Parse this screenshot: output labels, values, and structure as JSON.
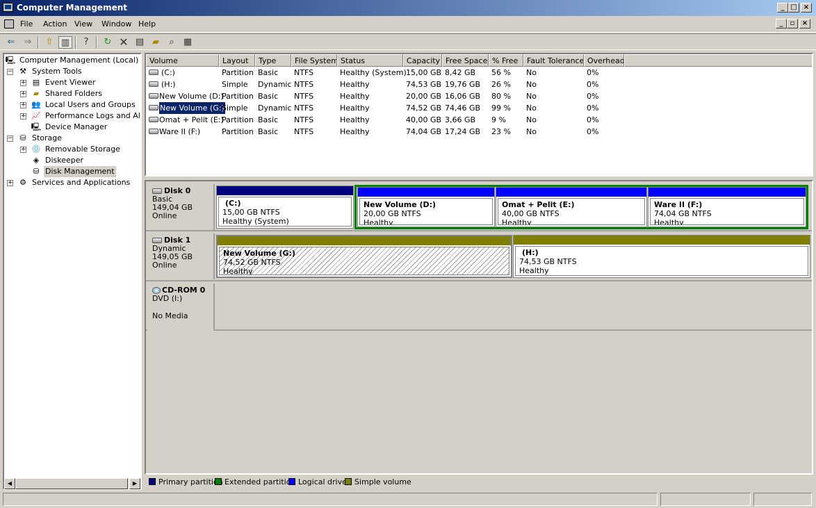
{
  "window": {
    "title": "Computer Management"
  },
  "menu": [
    "File",
    "Action",
    "View",
    "Window",
    "Help"
  ],
  "tree": {
    "root": "Computer Management (Local)",
    "system_tools": "System Tools",
    "event_viewer": "Event Viewer",
    "shared_folders": "Shared Folders",
    "local_users": "Local Users and Groups",
    "perf_logs": "Performance Logs and Alerts",
    "device_manager": "Device Manager",
    "storage": "Storage",
    "removable_storage": "Removable Storage",
    "diskeeper": "Diskeeper",
    "disk_management": "Disk Management",
    "services": "Services and Applications"
  },
  "list": {
    "columns": [
      "Volume",
      "Layout",
      "Type",
      "File System",
      "Status",
      "Capacity",
      "Free Space",
      "% Free",
      "Fault Tolerance",
      "Overhead"
    ],
    "rows": [
      [
        "(C:)",
        "Partition",
        "Basic",
        "NTFS",
        "Healthy (System)",
        "15,00 GB",
        "8,42 GB",
        "56 %",
        "No",
        "0%"
      ],
      [
        "(H:)",
        "Simple",
        "Dynamic",
        "NTFS",
        "Healthy",
        "74,53 GB",
        "19,76 GB",
        "26 %",
        "No",
        "0%"
      ],
      [
        "New Volume (D:)",
        "Partition",
        "Basic",
        "NTFS",
        "Healthy",
        "20,00 GB",
        "16,06 GB",
        "80 %",
        "No",
        "0%"
      ],
      [
        "New Volume (G:)",
        "Simple",
        "Dynamic",
        "NTFS",
        "Healthy",
        "74,52 GB",
        "74,46 GB",
        "99 %",
        "No",
        "0%"
      ],
      [
        "Omat + Pelit (E:)",
        "Partition",
        "Basic",
        "NTFS",
        "Healthy",
        "40,00 GB",
        "3,66 GB",
        "9 %",
        "No",
        "0%"
      ],
      [
        "Ware II (F:)",
        "Partition",
        "Basic",
        "NTFS",
        "Healthy",
        "74,04 GB",
        "17,24 GB",
        "23 %",
        "No",
        "0%"
      ]
    ]
  },
  "disks": {
    "d0": {
      "name": "Disk 0",
      "type": "Basic",
      "size": "149,04 GB",
      "state": "Online"
    },
    "d1": {
      "name": "Disk 1",
      "type": "Dynamic",
      "size": "149,05 GB",
      "state": "Online"
    },
    "cd": {
      "name": "CD-ROM 0",
      "type": "DVD (I:)",
      "state": "No Media"
    }
  },
  "volumes": {
    "c": {
      "name": "(C:)",
      "size": "15,00 GB NTFS",
      "status": "Healthy (System)"
    },
    "d": {
      "name": "New Volume  (D:)",
      "size": "20,00 GB NTFS",
      "status": "Healthy"
    },
    "e": {
      "name": "Omat + Pelit  (E:)",
      "size": "40,00 GB NTFS",
      "status": "Healthy"
    },
    "f": {
      "name": "Ware II  (F:)",
      "size": "74,04 GB NTFS",
      "status": "Healthy"
    },
    "g": {
      "name": "New Volume  (G:)",
      "size": "74,52 GB NTFS",
      "status": "Healthy"
    },
    "h": {
      "name": "(H:)",
      "size": "74,53 GB NTFS",
      "status": "Healthy"
    }
  },
  "legend": {
    "primary": "Primary partition",
    "extended": "Extended partition",
    "logical": "Logical drive",
    "simple": "Simple volume"
  },
  "colors": {
    "primary": "#000080",
    "extended": "#008000",
    "logical": "#0000ff",
    "simple": "#808000",
    "selection": "#0a246a"
  }
}
